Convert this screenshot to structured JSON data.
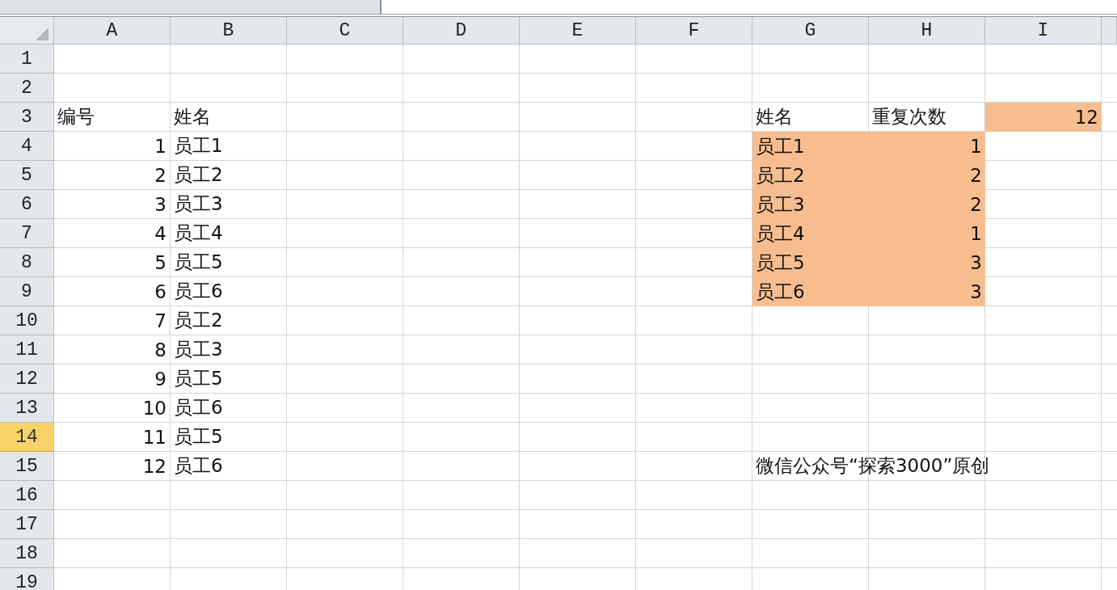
{
  "columns": [
    {
      "label": "A"
    },
    {
      "label": "B"
    },
    {
      "label": "C"
    },
    {
      "label": "D"
    },
    {
      "label": "E"
    },
    {
      "label": "F"
    },
    {
      "label": "G"
    },
    {
      "label": "H"
    },
    {
      "label": "I"
    }
  ],
  "rows": [
    {
      "label": "1",
      "selected": false,
      "cells": {}
    },
    {
      "label": "2",
      "selected": false,
      "cells": {}
    },
    {
      "label": "3",
      "selected": false,
      "cells": {
        "A": {
          "kind": "text",
          "text": "编号",
          "highlighted": false
        },
        "B": {
          "kind": "text",
          "text": "姓名",
          "highlighted": false
        },
        "G": {
          "kind": "text",
          "text": "姓名",
          "highlighted": false
        },
        "H": {
          "kind": "text",
          "text": "重复次数",
          "highlighted": false
        },
        "I": {
          "kind": "number",
          "text": "12",
          "highlighted": true
        }
      }
    },
    {
      "label": "4",
      "selected": false,
      "cells": {
        "A": {
          "kind": "number",
          "text": "1",
          "highlighted": false
        },
        "B": {
          "kind": "text",
          "text": "员工1",
          "highlighted": false
        },
        "G": {
          "kind": "text",
          "text": "员工1",
          "highlighted": true
        },
        "H": {
          "kind": "number",
          "text": "1",
          "highlighted": true
        }
      }
    },
    {
      "label": "5",
      "selected": false,
      "cells": {
        "A": {
          "kind": "number",
          "text": "2",
          "highlighted": false
        },
        "B": {
          "kind": "text",
          "text": "员工2",
          "highlighted": false
        },
        "G": {
          "kind": "text",
          "text": "员工2",
          "highlighted": true
        },
        "H": {
          "kind": "number",
          "text": "2",
          "highlighted": true
        }
      }
    },
    {
      "label": "6",
      "selected": false,
      "cells": {
        "A": {
          "kind": "number",
          "text": "3",
          "highlighted": false
        },
        "B": {
          "kind": "text",
          "text": "员工3",
          "highlighted": false
        },
        "G": {
          "kind": "text",
          "text": "员工3",
          "highlighted": true
        },
        "H": {
          "kind": "number",
          "text": "2",
          "highlighted": true
        }
      }
    },
    {
      "label": "7",
      "selected": false,
      "cells": {
        "A": {
          "kind": "number",
          "text": "4",
          "highlighted": false
        },
        "B": {
          "kind": "text",
          "text": "员工4",
          "highlighted": false
        },
        "G": {
          "kind": "text",
          "text": "员工4",
          "highlighted": true
        },
        "H": {
          "kind": "number",
          "text": "1",
          "highlighted": true
        }
      }
    },
    {
      "label": "8",
      "selected": false,
      "cells": {
        "A": {
          "kind": "number",
          "text": "5",
          "highlighted": false
        },
        "B": {
          "kind": "text",
          "text": "员工5",
          "highlighted": false
        },
        "G": {
          "kind": "text",
          "text": "员工5",
          "highlighted": true
        },
        "H": {
          "kind": "number",
          "text": "3",
          "highlighted": true
        }
      }
    },
    {
      "label": "9",
      "selected": false,
      "cells": {
        "A": {
          "kind": "number",
          "text": "6",
          "highlighted": false
        },
        "B": {
          "kind": "text",
          "text": "员工6",
          "highlighted": false
        },
        "G": {
          "kind": "text",
          "text": "员工6",
          "highlighted": true
        },
        "H": {
          "kind": "number",
          "text": "3",
          "highlighted": true
        }
      }
    },
    {
      "label": "10",
      "selected": false,
      "cells": {
        "A": {
          "kind": "number",
          "text": "7",
          "highlighted": false
        },
        "B": {
          "kind": "text",
          "text": "员工2",
          "highlighted": false
        }
      }
    },
    {
      "label": "11",
      "selected": false,
      "cells": {
        "A": {
          "kind": "number",
          "text": "8",
          "highlighted": false
        },
        "B": {
          "kind": "text",
          "text": "员工3",
          "highlighted": false
        }
      }
    },
    {
      "label": "12",
      "selected": false,
      "cells": {
        "A": {
          "kind": "number",
          "text": "9",
          "highlighted": false
        },
        "B": {
          "kind": "text",
          "text": "员工5",
          "highlighted": false
        }
      }
    },
    {
      "label": "13",
      "selected": false,
      "cells": {
        "A": {
          "kind": "number",
          "text": "10",
          "highlighted": false
        },
        "B": {
          "kind": "text",
          "text": "员工6",
          "highlighted": false
        }
      }
    },
    {
      "label": "14",
      "selected": true,
      "cells": {
        "A": {
          "kind": "number",
          "text": "11",
          "highlighted": false
        },
        "B": {
          "kind": "text",
          "text": "员工5",
          "highlighted": false
        }
      }
    },
    {
      "label": "15",
      "selected": false,
      "cells": {
        "A": {
          "kind": "number",
          "text": "12",
          "highlighted": false
        },
        "B": {
          "kind": "text",
          "text": "员工6",
          "highlighted": false
        },
        "G": {
          "kind": "text",
          "text": "微信公众号“探索3000”原创",
          "highlighted": false
        }
      }
    },
    {
      "label": "16",
      "selected": false,
      "cells": {}
    },
    {
      "label": "17",
      "selected": false,
      "cells": {}
    },
    {
      "label": "18",
      "selected": false,
      "cells": {}
    },
    {
      "label": "19",
      "selected": false,
      "cells": {}
    }
  ]
}
